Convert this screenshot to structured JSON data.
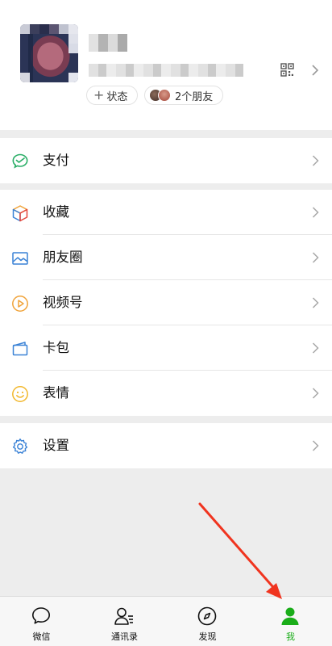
{
  "profile": {
    "status_label": "状态",
    "friends_label": "2个朋友",
    "avatar_icon": "avatar-blurred",
    "qr_icon": "qr-code-icon"
  },
  "menu": {
    "pay": {
      "label": "支付",
      "icon": "wechat-pay-icon"
    },
    "favorites": {
      "label": "收藏",
      "icon": "cube-icon"
    },
    "moments": {
      "label": "朋友圈",
      "icon": "picture-icon"
    },
    "channels": {
      "label": "视频号",
      "icon": "play-circle-icon"
    },
    "cards": {
      "label": "卡包",
      "icon": "card-icon"
    },
    "stickers": {
      "label": "表情",
      "icon": "smile-icon"
    },
    "settings": {
      "label": "设置",
      "icon": "gear-icon"
    }
  },
  "tabs": [
    {
      "label": "微信",
      "icon": "chat-bubble-icon"
    },
    {
      "label": "通讯录",
      "icon": "contacts-icon"
    },
    {
      "label": "发现",
      "icon": "compass-icon"
    },
    {
      "label": "我",
      "icon": "person-icon",
      "active": true
    }
  ],
  "colors": {
    "accent": "#1aad19",
    "arrow": "#f0341f"
  }
}
